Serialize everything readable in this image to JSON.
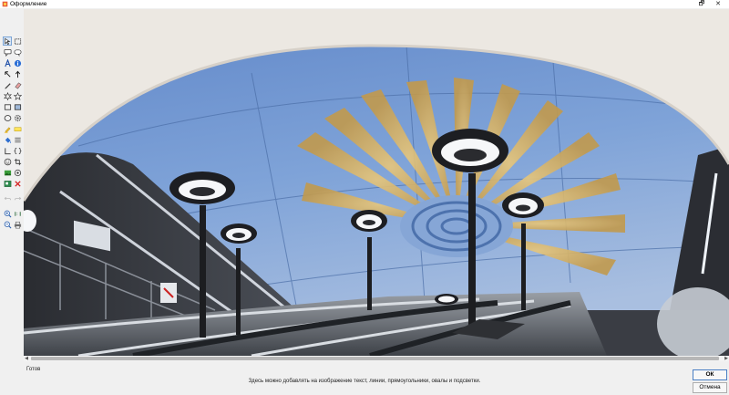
{
  "window": {
    "title": "Оформление",
    "controls": {
      "restore": "🗗",
      "close": "✕"
    }
  },
  "toolbar": {
    "tools": [
      "select-tool",
      "rect-select-tool",
      "speech-bubble-tool",
      "callout-tool",
      "text-tool",
      "info-icon",
      "arrow-left-tool",
      "arrow-up-tool",
      "pen-tool",
      "eraser-tool",
      "starburst-tool",
      "star-tool",
      "rectangle-tool",
      "filled-rectangle-tool",
      "ellipse-tool",
      "gear-icon",
      "highlighter-tool",
      "marker-tool",
      "fill-tool",
      "lines-tool",
      "angle-tool",
      "brackets-tool",
      "smiley-tool",
      "crop-tool",
      "green-image-tool",
      "target-tool",
      "image-tool",
      "delete-tool",
      "undo-tool",
      "redo-tool",
      "zoom-in-tool",
      "actual-size-tool",
      "zoom-out-tool",
      "print-tool"
    ]
  },
  "canvas": {
    "image_alt": "metro-station-escalator-photo"
  },
  "scrollbar": {
    "left_arrow": "◀",
    "right_arrow": "▶"
  },
  "status": {
    "text": "Готов"
  },
  "hint": {
    "text": "Здесь можно добавлять на изображение текст, линии, прямоугольники, овалы и подсветки."
  },
  "buttons": {
    "ok": "ОК",
    "cancel": "Отмена"
  },
  "colors": {
    "accent": "#4a7fc4",
    "ceiling": "#6f96d2",
    "gold": "#c9a45a",
    "arch": "#ece8e2"
  }
}
